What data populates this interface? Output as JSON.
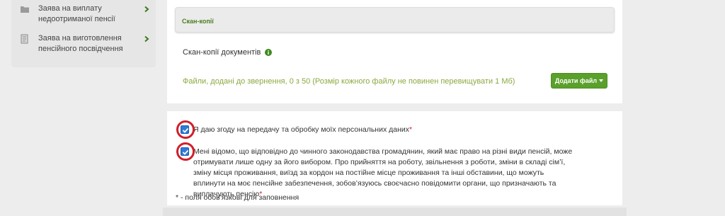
{
  "sidebar": {
    "items": [
      {
        "label": "Заява на виплату недоотриманої пенсії",
        "icon": "folder-icon"
      },
      {
        "label": "Заява на виготовлення пенсійного посвідчення",
        "icon": "document-icon"
      }
    ]
  },
  "scan_section": {
    "header": "Скан-копії",
    "docs_label": "Скан-копії документів",
    "files_info": "Файли, додані до звернення, 0 з 50 (Розмір кожного файлу не повинен перевищувати 1 Мб)",
    "add_file_label": "Додати файл"
  },
  "consents": [
    {
      "text": "Я даю згоду на передачу та обробку моїх персональних даних",
      "required_mark": "*",
      "checked": true
    },
    {
      "text": "Мені відомо, що відповідно до чинного законодавства громадянин, який має право на різні види пенсій, може отримувати лише одну за його вибором. Про прийняття на роботу, звільнення з роботи, зміни в складі сім’ї, зміну місця проживання, виїзд за кордон на постійне місце проживання та інші обставини, що можуть вплинути на моє пенсійне забезпечення, зобов’язуюсь своєчасно повідомити органи, що призначають та виплачують пенсію",
      "required_mark": "*",
      "checked": true
    }
  ],
  "footnote": "* - поля обов'язкові для заповнення",
  "colors": {
    "accent_green": "#5aa02b",
    "header_green": "#4a7f1f",
    "info_text_green": "#8ca93f",
    "checkbox_blue": "#2f7bd6",
    "annotation_red": "#d0202a"
  }
}
